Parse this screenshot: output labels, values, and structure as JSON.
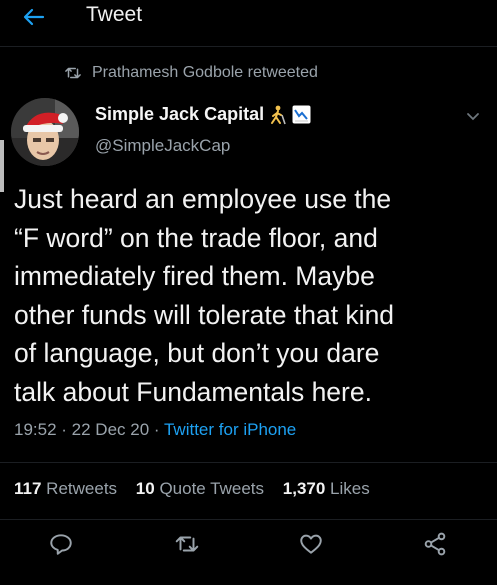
{
  "header": {
    "title": "Tweet"
  },
  "retweet": {
    "text": "Prathamesh Godbole retweeted"
  },
  "author": {
    "name": "Simple Jack Capital",
    "handle": "@SimpleJackCap"
  },
  "tweet": {
    "text": "Just heard an employee use the\n“F word” on the trade floor, and\nimmediately fired them. Maybe\nother funds will tolerate that kind\nof language, but don’t you dare\ntalk about Fundamentals here.",
    "time": "19:52",
    "date": "22 Dec 20",
    "source": "Twitter for iPhone"
  },
  "stats": {
    "retweets_count": "117",
    "retweets_label": "Retweets",
    "quotes_count": "10",
    "quotes_label": "Quote Tweets",
    "likes_count": "1,370",
    "likes_label": "Likes"
  },
  "icons": {
    "back": "arrow-left-icon",
    "retweet": "retweet-icon",
    "caret": "chevron-down-icon",
    "reply": "reply-icon",
    "like": "heart-icon",
    "share": "share-icon"
  },
  "colors": {
    "background": "#000000",
    "accent": "#1da1f2",
    "secondary_text": "#9aa3ab"
  }
}
